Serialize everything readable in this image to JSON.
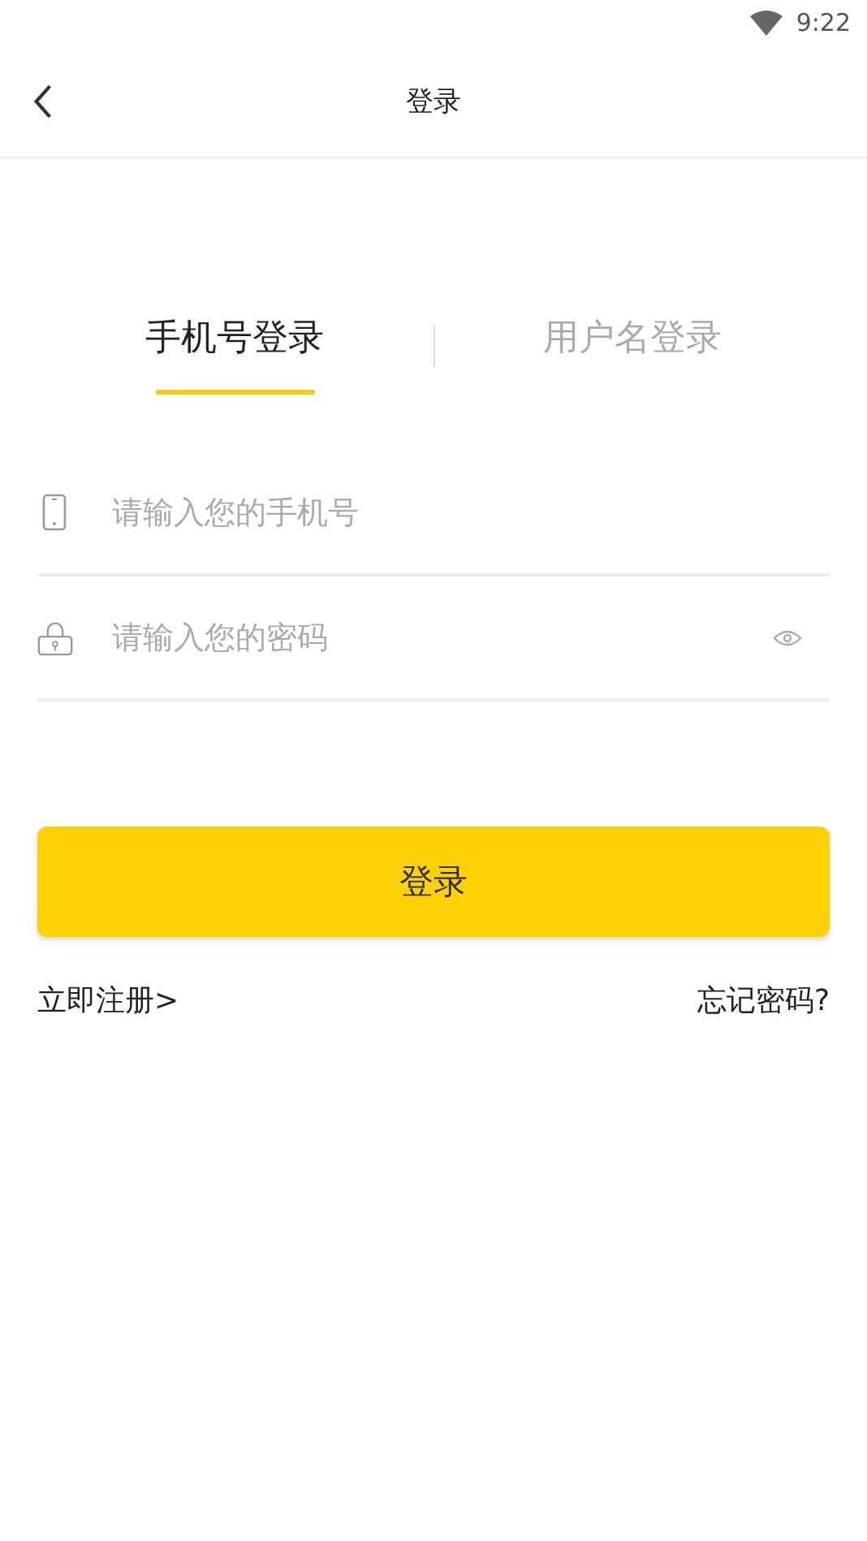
{
  "status_bar": {
    "time": "9:22"
  },
  "header": {
    "title": "登录"
  },
  "tabs": [
    {
      "label": "手机号登录",
      "selected": true
    },
    {
      "label": "用户名登录",
      "selected": false
    }
  ],
  "fields": [
    {
      "kind": "phone",
      "placeholder": "请输入您的手机号"
    },
    {
      "kind": "password",
      "placeholder": "请输入您的密码"
    }
  ],
  "login_button": "登录",
  "register_link": "立即注册>",
  "forgot_link": "忘记密码?"
}
